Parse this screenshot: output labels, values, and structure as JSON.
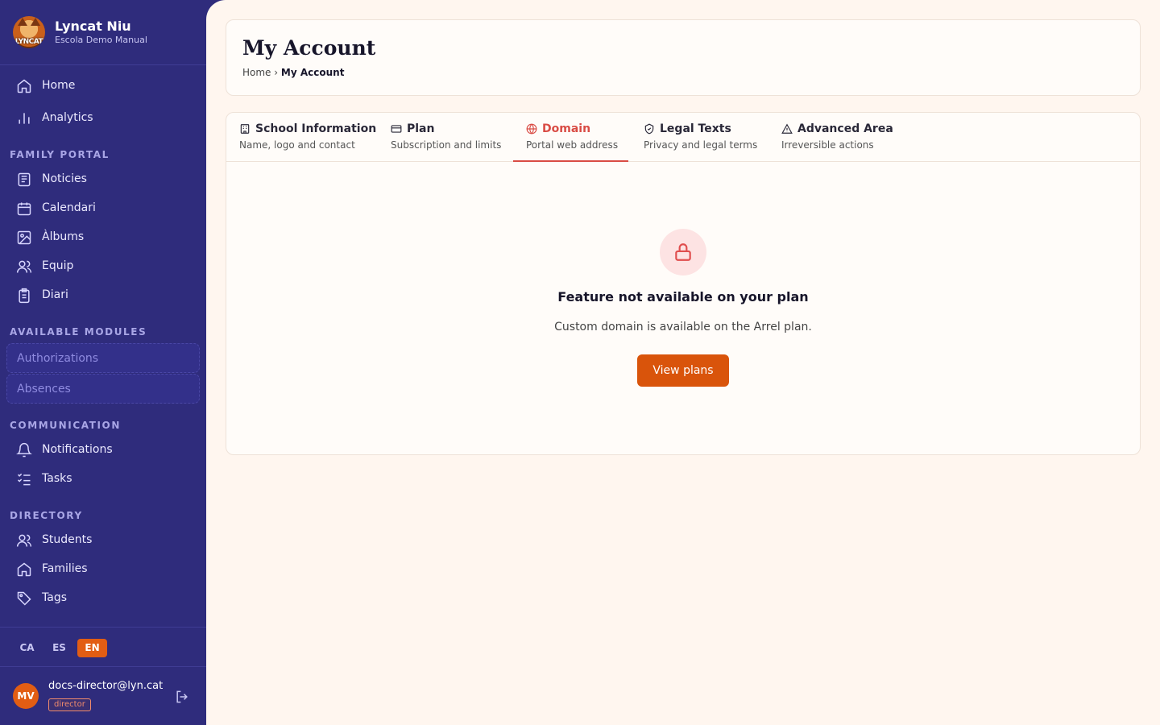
{
  "brand": {
    "name": "Lyncat Niu",
    "subtitle": "Escola Demo Manual",
    "logo_text": "LYNCAT"
  },
  "sidebar": {
    "top_items": [
      {
        "label": "Home",
        "icon": "home-icon"
      },
      {
        "label": "Analytics",
        "icon": "bar-chart-icon"
      }
    ],
    "family_portal": {
      "heading": "FAMILY PORTAL",
      "items": [
        {
          "label": "Noticies",
          "icon": "newspaper-icon"
        },
        {
          "label": "Calendari",
          "icon": "calendar-icon"
        },
        {
          "label": "Àlbums",
          "icon": "image-icon"
        },
        {
          "label": "Equip",
          "icon": "users-icon"
        },
        {
          "label": "Diari",
          "icon": "clipboard-icon"
        }
      ]
    },
    "modules": {
      "heading": "AVAILABLE MODULES",
      "items": [
        {
          "label": "Authorizations"
        },
        {
          "label": "Absences"
        }
      ]
    },
    "communication": {
      "heading": "COMMUNICATION",
      "items": [
        {
          "label": "Notifications",
          "icon": "bell-icon"
        },
        {
          "label": "Tasks",
          "icon": "checklist-icon"
        }
      ]
    },
    "directory": {
      "heading": "DIRECTORY",
      "items": [
        {
          "label": "Students",
          "icon": "users-icon"
        },
        {
          "label": "Families",
          "icon": "home-icon"
        },
        {
          "label": "Tags",
          "icon": "tag-icon"
        }
      ]
    },
    "languages": [
      {
        "code": "CA"
      },
      {
        "code": "ES"
      },
      {
        "code": "EN",
        "active": true
      }
    ],
    "user": {
      "initials": "MV",
      "email": "docs-director@lyn.cat",
      "role": "director"
    }
  },
  "header": {
    "title": "My Account",
    "breadcrumb": {
      "home": "Home",
      "separator": "›",
      "current": "My Account"
    }
  },
  "tabs": [
    {
      "title": "School Information",
      "subtitle": "Name, logo and contact",
      "icon": "building-icon"
    },
    {
      "title": "Plan",
      "subtitle": "Subscription and limits",
      "icon": "credit-card-icon"
    },
    {
      "title": "Domain",
      "subtitle": "Portal web address",
      "icon": "globe-icon",
      "active": true
    },
    {
      "title": "Legal Texts",
      "subtitle": "Privacy and legal terms",
      "icon": "shield-check-icon"
    },
    {
      "title": "Advanced Area",
      "subtitle": "Irreversible actions",
      "icon": "warning-icon"
    }
  ],
  "empty_state": {
    "icon": "lock-icon",
    "title": "Feature not available on your plan",
    "message": "Custom domain is available on the Arrel plan.",
    "button_label": "View plans"
  },
  "colors": {
    "sidebar_bg": "#2f2c7c",
    "accent": "#d9540b",
    "active_tab": "#d94c45",
    "page_bg": "#fff6ef"
  }
}
